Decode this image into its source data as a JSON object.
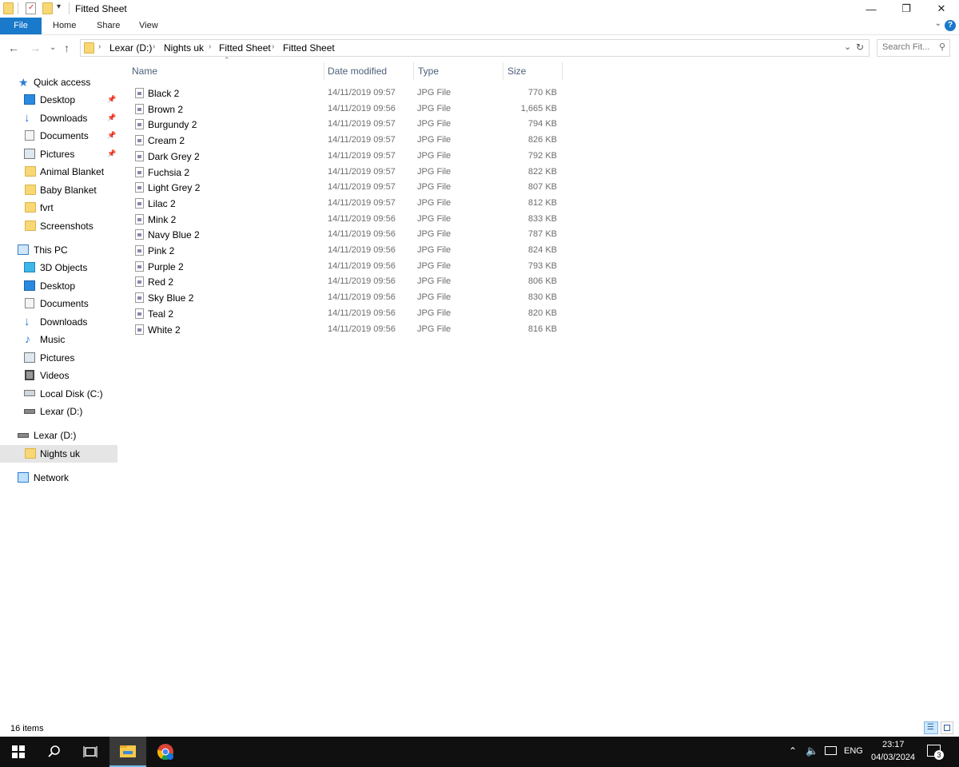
{
  "window": {
    "title": "Fitted Sheet",
    "controls": {
      "minimize": "—",
      "restore": "❐",
      "close": "✕"
    }
  },
  "ribbon": {
    "tabs": [
      "File",
      "Home",
      "Share",
      "View"
    ],
    "help": "?"
  },
  "address": {
    "crumbs": [
      "Lexar (D:)",
      "Nights uk",
      "Fitted Sheet",
      "Fitted Sheet"
    ],
    "search_placeholder": "Search Fit..."
  },
  "sidebar": {
    "quick_access": {
      "label": "Quick access",
      "items": [
        {
          "label": "Desktop",
          "pinned": true
        },
        {
          "label": "Downloads",
          "pinned": true
        },
        {
          "label": "Documents",
          "pinned": true
        },
        {
          "label": "Pictures",
          "pinned": true
        },
        {
          "label": "Animal Blanket",
          "pinned": false
        },
        {
          "label": "Baby Blanket",
          "pinned": false
        },
        {
          "label": "fvrt",
          "pinned": false
        },
        {
          "label": "Screenshots",
          "pinned": false
        }
      ]
    },
    "this_pc": {
      "label": "This PC",
      "items": [
        "3D Objects",
        "Desktop",
        "Documents",
        "Downloads",
        "Music",
        "Pictures",
        "Videos",
        "Local Disk (C:)",
        "Lexar (D:)"
      ]
    },
    "drive": {
      "label": "Lexar (D:)",
      "child": "Nights uk"
    },
    "network": "Network"
  },
  "columns": {
    "name": "Name",
    "date": "Date modified",
    "type": "Type",
    "size": "Size"
  },
  "files": [
    {
      "name": "Black 2",
      "date": "14/11/2019 09:57",
      "type": "JPG File",
      "size": "770 KB"
    },
    {
      "name": "Brown 2",
      "date": "14/11/2019 09:56",
      "type": "JPG File",
      "size": "1,665 KB"
    },
    {
      "name": "Burgundy 2",
      "date": "14/11/2019 09:57",
      "type": "JPG File",
      "size": "794 KB"
    },
    {
      "name": "Cream 2",
      "date": "14/11/2019 09:57",
      "type": "JPG File",
      "size": "826 KB"
    },
    {
      "name": "Dark Grey 2",
      "date": "14/11/2019 09:57",
      "type": "JPG File",
      "size": "792 KB"
    },
    {
      "name": "Fuchsia 2",
      "date": "14/11/2019 09:57",
      "type": "JPG File",
      "size": "822 KB"
    },
    {
      "name": "Light Grey 2",
      "date": "14/11/2019 09:57",
      "type": "JPG File",
      "size": "807 KB"
    },
    {
      "name": "Lilac 2",
      "date": "14/11/2019 09:57",
      "type": "JPG File",
      "size": "812 KB"
    },
    {
      "name": "Mink 2",
      "date": "14/11/2019 09:56",
      "type": "JPG File",
      "size": "833 KB"
    },
    {
      "name": "Navy Blue 2",
      "date": "14/11/2019 09:56",
      "type": "JPG File",
      "size": "787 KB"
    },
    {
      "name": "Pink 2",
      "date": "14/11/2019 09:56",
      "type": "JPG File",
      "size": "824 KB"
    },
    {
      "name": "Purple 2",
      "date": "14/11/2019 09:56",
      "type": "JPG File",
      "size": "793 KB"
    },
    {
      "name": "Red 2",
      "date": "14/11/2019 09:56",
      "type": "JPG File",
      "size": "806 KB"
    },
    {
      "name": "Sky Blue 2",
      "date": "14/11/2019 09:56",
      "type": "JPG File",
      "size": "830 KB"
    },
    {
      "name": "Teal 2",
      "date": "14/11/2019 09:56",
      "type": "JPG File",
      "size": "820 KB"
    },
    {
      "name": "White 2",
      "date": "14/11/2019 09:56",
      "type": "JPG File",
      "size": "816 KB"
    }
  ],
  "status": {
    "count": "16 items"
  },
  "taskbar": {
    "language": "ENG",
    "time": "23:17",
    "date": "04/03/2024",
    "notifications": "3"
  },
  "colors": {
    "accent": "#1979ca",
    "selected": "#cce8ff",
    "taskbar": "#101010"
  }
}
